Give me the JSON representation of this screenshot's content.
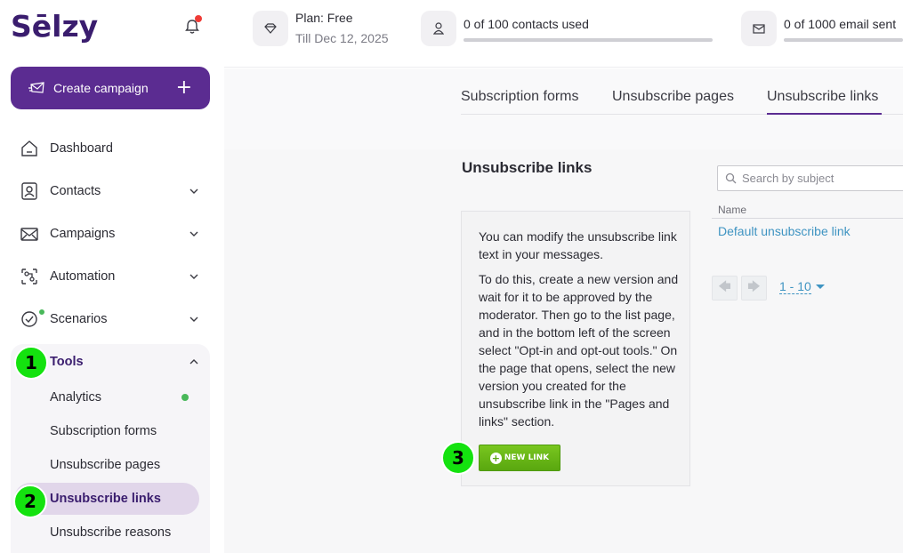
{
  "app": {
    "logo": "Sēlzy"
  },
  "sidebar": {
    "create_label": "Create campaign",
    "create_icon": "plus-icon",
    "items": [
      {
        "label": "Dashboard",
        "icon": "home-icon"
      },
      {
        "label": "Contacts",
        "icon": "contacts-icon"
      },
      {
        "label": "Campaigns",
        "icon": "envelope-icon"
      },
      {
        "label": "Automation",
        "icon": "automation-icon"
      },
      {
        "label": "Scenarios",
        "icon": "scenarios-icon"
      },
      {
        "label": "Tools",
        "icon": "none"
      }
    ],
    "tools_sub": [
      {
        "label": "Analytics"
      },
      {
        "label": "Subscription forms"
      },
      {
        "label": "Unsubscribe pages"
      },
      {
        "label": "Unsubscribe links"
      },
      {
        "label": "Unsubscribe reasons"
      }
    ],
    "brand_color": "#5b2c91",
    "active_bg": "#e1d6ea"
  },
  "topbar": {
    "plan_label": "Plan: Free",
    "plan_date": "Till Dec 12, 2025",
    "contacts_used": "0 of 100 contacts used",
    "emails_sent": "0 of 1000 email sent",
    "contacts_progress": 0,
    "emails_progress": 0
  },
  "tabs": [
    "Subscription forms",
    "Unsubscribe pages",
    "Unsubscribe links"
  ],
  "active_tab": "Unsubscribe links",
  "content": {
    "title": "Unsubscribe links",
    "info_p1": "You can modify the unsubscribe link text in your messages.",
    "info_p2": "To do this, create a new version and wait for it to be approved by the moderator. Then go to the list page, and in the bottom left of the screen select \"Opt-in and opt-out tools.\" On the page that opens, select the new version you created for the unsubscribe link in the \"Pages and links\" section.",
    "new_link_label": "NEW LINK",
    "search_placeholder": "Search by subject",
    "column_name": "Name",
    "rows": [
      "Default unsubscribe link"
    ],
    "pagination_range": "1 - 10"
  },
  "markers": [
    "1",
    "2",
    "3"
  ]
}
